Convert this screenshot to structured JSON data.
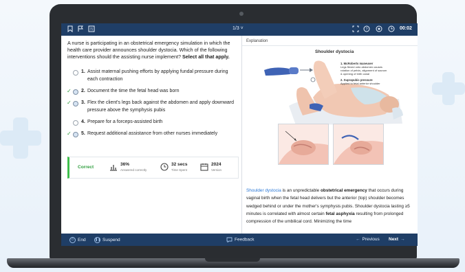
{
  "topbar": {
    "page": "1/3 ˅",
    "time": "00:02",
    "icons_left": [
      "bookmark-icon",
      "flag-icon",
      "calculator-icon"
    ],
    "icons_right": [
      "fullscreen-icon",
      "help-icon",
      "settings-icon",
      "clock-icon"
    ]
  },
  "question": {
    "text": "A nurse is participating in an obstetrical emergency simulation in which the health care provider announces shoulder dystocia. Which of the following interventions should the assisting nurse implement? ",
    "instruction": "Select all that apply."
  },
  "options": [
    {
      "num": "1.",
      "text": "Assist maternal pushing efforts by applying fundal pressure during each contraction",
      "checked": false
    },
    {
      "num": "2.",
      "text": "Document the time the fetal head was born",
      "checked": true
    },
    {
      "num": "3.",
      "text": "Flex the client's legs back against the abdomen and apply downward pressure above the symphysis pubis",
      "checked": true
    },
    {
      "num": "4.",
      "text": "Prepare for a forceps-assisted birth",
      "checked": false
    },
    {
      "num": "5.",
      "text": "Request additional assistance from other nurses immediately",
      "checked": true
    }
  ],
  "result": {
    "status": "Correct",
    "stats": [
      {
        "icon": "bar-chart-icon",
        "value": "36%",
        "label": "Answered correctly"
      },
      {
        "icon": "clock-icon",
        "value": "32 secs",
        "label": "Time Spent"
      },
      {
        "icon": "calendar-icon",
        "value": "2024",
        "label": "Version"
      }
    ]
  },
  "explanation": {
    "label": "Explanation",
    "figure_title": "Shoulder dystocia",
    "annotations": [
      {
        "title": "1. McRoberts maneuver",
        "lines": [
          "Legs flexed onto abdomen causes",
          "rotation of pelvis, alignment of sacrum",
          "& opening of birth canal"
        ]
      },
      {
        "title": "2. Suprapubic pressure",
        "lines": [
          "Applied to fetal anterior shoulder"
        ]
      }
    ],
    "body": {
      "link": "Shoulder dystocia",
      "p1": " is an unpredictable ",
      "b1": "obstetrical emergency",
      "p2": " that occurs during vaginal birth when the fetal head delivers but the anterior (top) shoulder becomes wedged behind or under the mother's symphysis pubis. Shoulder dystocia lasting ≥5 minutes is correlated with almost certain ",
      "b2": "fetal asphyxia",
      "p3": " resulting from prolonged compression of the umbilical cord. Minimizing the time"
    }
  },
  "bottombar": {
    "end": "End",
    "suspend": "Suspend",
    "feedback": "Feedback",
    "previous": "Previous",
    "next": "Next"
  },
  "colors": {
    "bar": "#1f3e66",
    "correct": "#3fbf4c",
    "link": "#2b78d6"
  }
}
